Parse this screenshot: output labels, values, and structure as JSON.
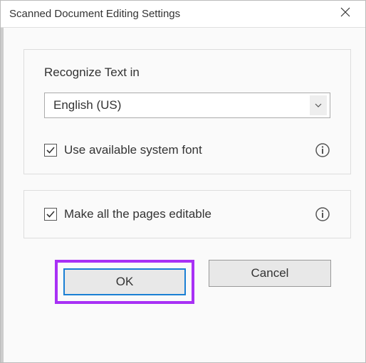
{
  "title": "Scanned Document Editing Settings",
  "panel1": {
    "label": "Recognize Text in",
    "dropdown_value": "English (US)",
    "checkbox_label": "Use available system font",
    "checkbox_checked": true
  },
  "panel2": {
    "checkbox_label": "Make all the pages editable",
    "checkbox_checked": true
  },
  "buttons": {
    "ok": "OK",
    "cancel": "Cancel"
  }
}
